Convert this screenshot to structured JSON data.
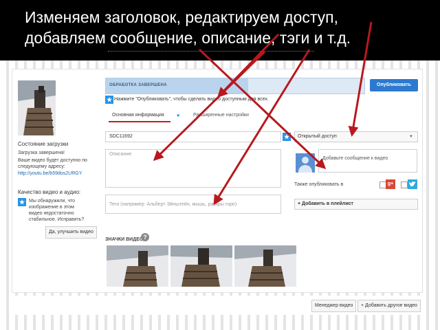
{
  "slide": {
    "title_line1": "Изменяем заголовок, редактируем доступ,",
    "title_line2": "добавляем сообщение, описание, тэги и т.д."
  },
  "status_bar": {
    "text": "ОБРАБОТКА ЗАВЕРШЕНА",
    "progress": 0.55,
    "color": "#bad4ee"
  },
  "publish_button": {
    "label": "Опубликовать",
    "color": "#2c79cf"
  },
  "tip": {
    "text": "Нажмите \"Опубликовать\", чтобы сделать видео доступным для всех."
  },
  "tabs": [
    {
      "label": "Основная информация"
    },
    {
      "label": "Расширенные настройки"
    }
  ],
  "form": {
    "title_value": "SDC11692",
    "description_placeholder": "Описание",
    "tags_placeholder": "Теги (например: Альберт Эйнштейн, мышь, раскры горе)",
    "privacy_value": "Открытый доступ",
    "message_placeholder": "Добавьте сообщение к видео",
    "share_label": "Также опубликовать в",
    "playlist_label": "+ Добавить в плейлист",
    "thumbnails_label": "ЗНАЧКИ ВИДЕО"
  },
  "sidebar": {
    "upload_heading": "Состояние загрузки",
    "upload_status": "Загрузка завершена!",
    "available_text_1": "Ваше видео будет доступно по",
    "available_text_2": "следующему адресу:",
    "url": "http://youtu.be/b59dos2URGY",
    "quality_heading": "Качество видео и аудио:",
    "quality_msg_1": "Мы обнаружили, что",
    "quality_msg_2": "изображение в этом",
    "quality_msg_3": "видео недостаточно",
    "quality_msg_4": "стабильное. Исправить?",
    "improve_button": "Да, улучшить видео"
  },
  "footer": {
    "manager_button": "Менеджер видео",
    "add_more_button": "+ Добавить другое видео"
  },
  "icons": {
    "info": "info-star-icon",
    "google_plus": "google-plus-icon",
    "twitter": "twitter-bird-icon",
    "avatar": "avatar-silhouette-icon"
  },
  "colors": {
    "arrow": "#b8181e",
    "accent": "#2793e6"
  }
}
